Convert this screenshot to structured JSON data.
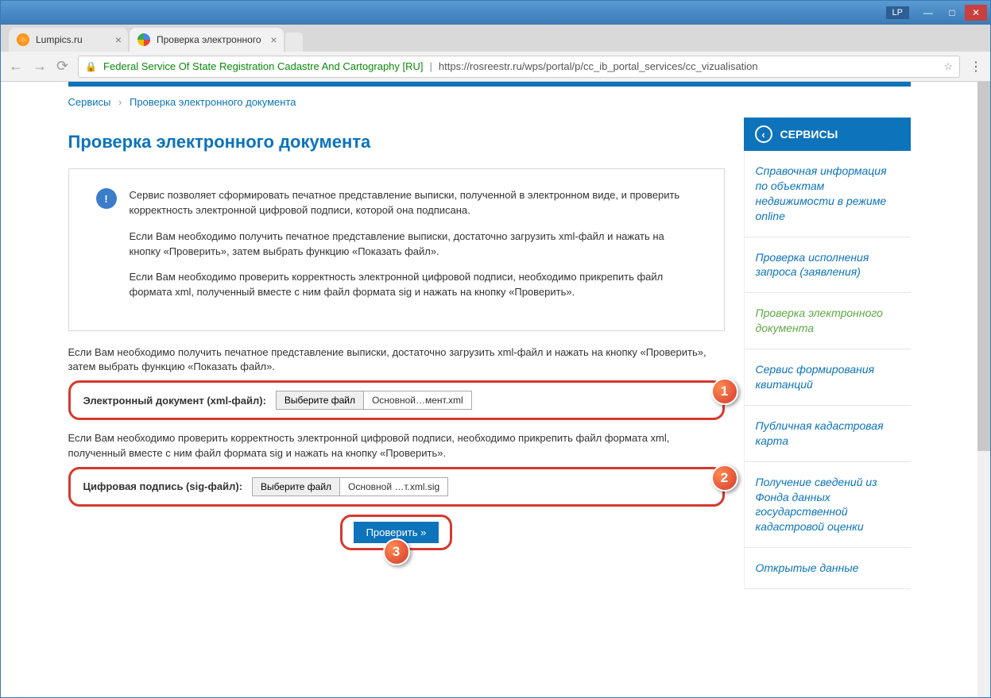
{
  "window": {
    "user": "LP"
  },
  "tabs": [
    {
      "title": "Lumpics.ru",
      "favicon": "orange",
      "active": false
    },
    {
      "title": "Проверка электронного",
      "favicon": "multi",
      "active": true
    }
  ],
  "address": {
    "org": "Federal Service Of State Registration Cadastre And Cartography [RU]",
    "url": "https://rosreestr.ru/wps/portal/p/cc_ib_portal_services/cc_vizualisation"
  },
  "breadcrumb": {
    "root": "Сервисы",
    "current": "Проверка электронного документа"
  },
  "title": "Проверка электронного документа",
  "info": {
    "p1": "Сервис позволяет сформировать печатное представление выписки, полученной в электронном виде, и проверить корректность электронной цифровой подписи, которой она подписана.",
    "p2": "Если Вам необходимо получить печатное представление выписки, достаточно загрузить xml-файл и нажать на кнопку «Проверить», затем выбрать функцию «Показать файл».",
    "p3": "Если Вам необходимо проверить корректность электронной цифровой подписи, необходимо прикрепить файл формата xml, полученный вместе с ним файл формата sig и нажать на кнопку «Проверить»."
  },
  "xml": {
    "note": "Если Вам необходимо получить печатное представление выписки, достаточно загрузить xml-файл и нажать на кнопку «Проверить», затем выбрать функцию «Показать файл».",
    "label": "Электронный документ (xml-файл):",
    "choose": "Выберите файл",
    "file": "Основной…мент.xml",
    "badge": "1"
  },
  "sig": {
    "note": "Если Вам необходимо проверить корректность электронной цифровой подписи, необходимо прикрепить файл формата xml, полученный вместе с ним файл формата sig и нажать на кнопку «Проверить».",
    "label": "Цифровая подпись (sig-файл):",
    "choose": "Выберите файл",
    "file": "Основной …т.xml.sig",
    "badge": "2"
  },
  "check": {
    "label": "Проверить »",
    "badge": "3"
  },
  "sidebar": {
    "title": "СЕРВИСЫ",
    "items": [
      "Справочная информация по объектам недвижимости в режиме online",
      "Проверка исполнения запроса (заявления)",
      "Проверка электронного документа",
      "Сервис формирования квитанций",
      "Публичная кадастровая карта",
      "Получение сведений из Фонда данных государственной кадастровой оценки",
      "Открытые данные"
    ],
    "active_index": 2
  }
}
